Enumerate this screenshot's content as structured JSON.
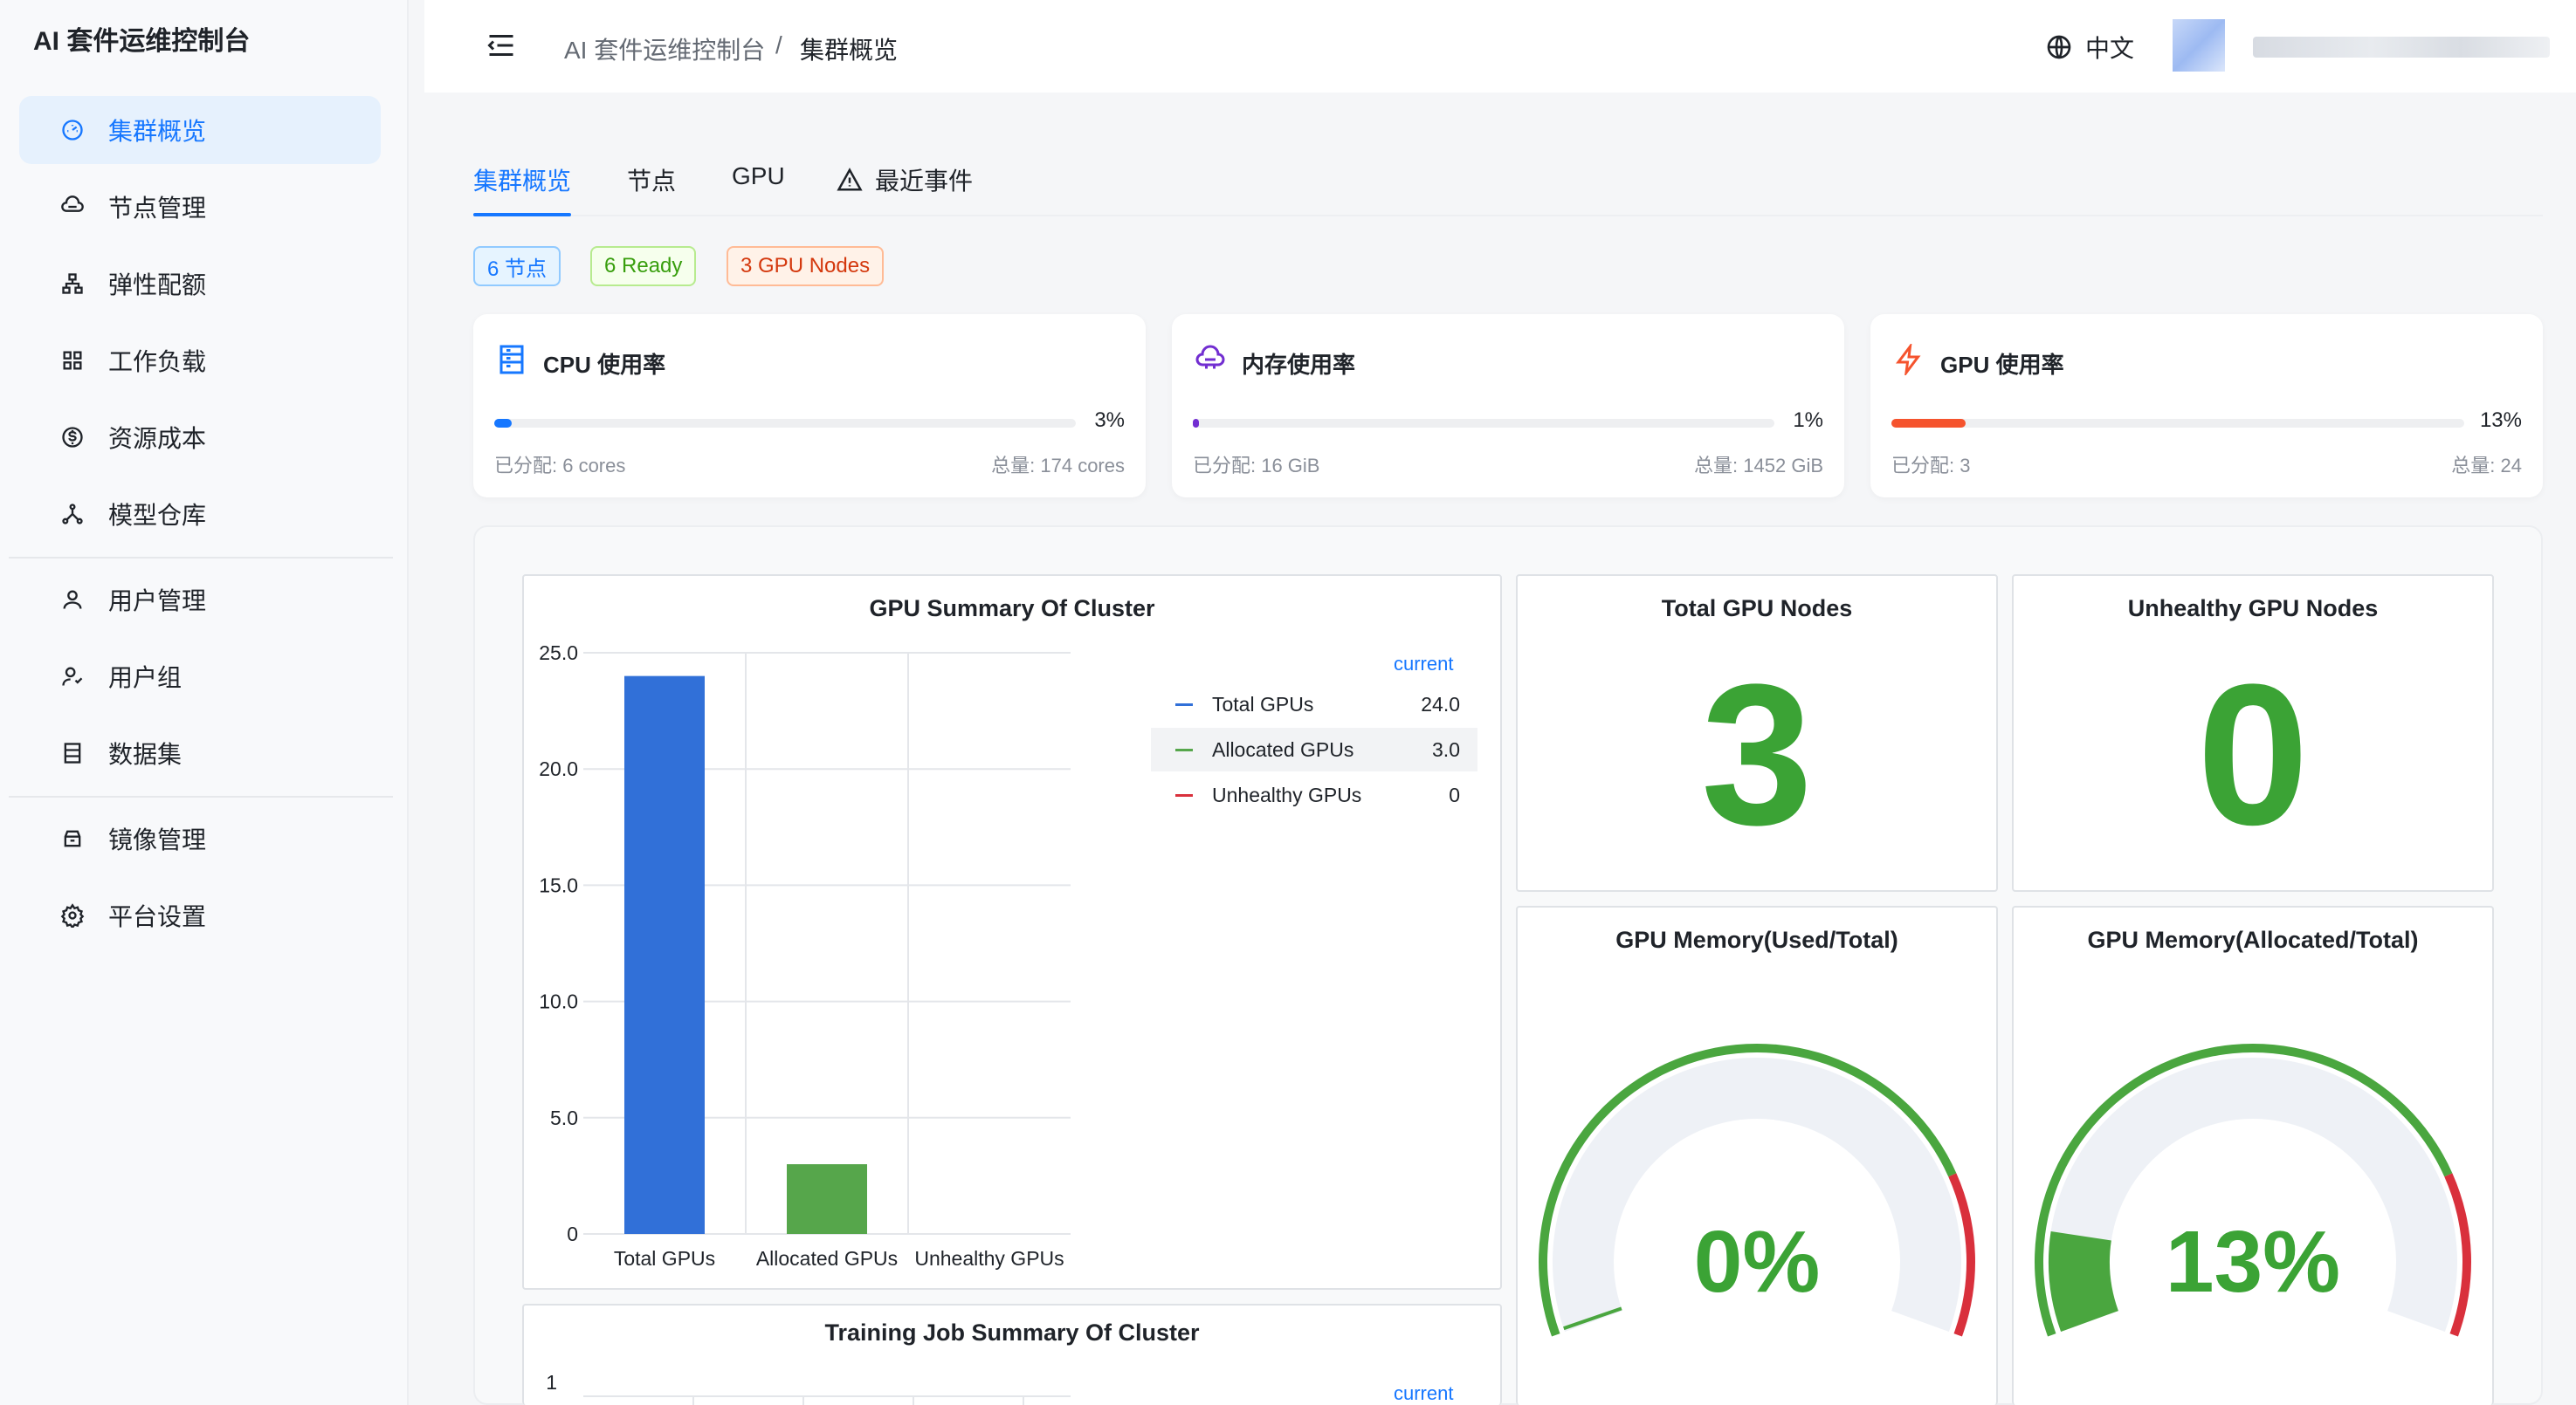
{
  "app": {
    "title": "AI 套件运维控制台"
  },
  "sidebar": {
    "items": [
      {
        "label": "集群概览",
        "icon": "dashboard-icon",
        "active": true
      },
      {
        "label": "节点管理",
        "icon": "cloud-node-icon"
      },
      {
        "label": "弹性配额",
        "icon": "cluster-icon"
      },
      {
        "label": "工作负载",
        "icon": "grid-icon"
      },
      {
        "label": "资源成本",
        "icon": "dollar-icon"
      },
      {
        "label": "模型仓库",
        "icon": "nodes-icon"
      },
      {
        "label": "用户管理",
        "icon": "user-icon"
      },
      {
        "label": "用户组",
        "icon": "user-group-icon"
      },
      {
        "label": "数据集",
        "icon": "dataset-icon"
      },
      {
        "label": "镜像管理",
        "icon": "image-box-icon"
      },
      {
        "label": "平台设置",
        "icon": "gear-icon"
      }
    ]
  },
  "header": {
    "breadcrumb": [
      "AI 套件运维控制台",
      "集群概览"
    ],
    "breadcrumb_sep": "/",
    "language": "中文"
  },
  "tabs": [
    {
      "label": "集群概览",
      "active": true
    },
    {
      "label": "节点"
    },
    {
      "label": "GPU"
    },
    {
      "label": "最近事件",
      "icon": "warning-icon"
    }
  ],
  "tags": [
    "6 节点",
    "6 Ready",
    "3 GPU Nodes"
  ],
  "stats": [
    {
      "title": "CPU 使用率",
      "percent_label": "3%",
      "percent": 3,
      "allocated": "已分配: 6 cores",
      "total": "总量: 174 cores",
      "color": "#1677ff",
      "icon": "server-icon"
    },
    {
      "title": "内存使用率",
      "percent_label": "1%",
      "percent": 1,
      "allocated": "已分配: 16 GiB",
      "total": "总量: 1452 GiB",
      "color": "#722ed1",
      "icon": "memory-icon"
    },
    {
      "title": "GPU 使用率",
      "percent_label": "13%",
      "percent": 13,
      "allocated": "已分配: 3",
      "total": "总量: 24",
      "color": "#f5532d",
      "icon": "lightning-icon"
    }
  ],
  "panels": {
    "gpu_summary_title": "GPU Summary Of Cluster",
    "total_gpu_nodes_title": "Total GPU Nodes",
    "total_gpu_nodes_value": "3",
    "unhealthy_gpu_nodes_title": "Unhealthy GPU Nodes",
    "unhealthy_gpu_nodes_value": "0",
    "mem_used_title": "GPU Memory(Used/Total)",
    "mem_used_value": "0%",
    "mem_alloc_title": "GPU Memory(Allocated/Total)",
    "mem_alloc_value": "13%",
    "training_title": "Training Job Summary Of Cluster",
    "legend_header": "current",
    "training_legend_header": "current"
  },
  "colors": {
    "green": "#3ba335",
    "red": "#d9303c",
    "blue": "#3170d8"
  },
  "chart_data": [
    {
      "type": "bar",
      "title": "GPU Summary Of Cluster",
      "categories": [
        "Total GPUs",
        "Allocated GPUs",
        "Unhealthy GPUs"
      ],
      "values": [
        24,
        3,
        0
      ],
      "colors": [
        "#3170d8",
        "#56a64b",
        "#d9303c"
      ],
      "ylim": [
        0,
        25
      ],
      "yticks": [
        "0",
        "5.0",
        "10.0",
        "15.0",
        "20.0",
        "25.0"
      ],
      "legend": [
        {
          "name": "Total GPUs",
          "value": "24.0",
          "color": "#3170d8"
        },
        {
          "name": "Allocated GPUs",
          "value": "3.0",
          "color": "#56a64b"
        },
        {
          "name": "Unhealthy GPUs",
          "value": "0",
          "color": "#d9303c"
        }
      ],
      "legend_placement": "right",
      "grid": true
    },
    {
      "type": "gauge",
      "title": "GPU Memory(Used/Total)",
      "value": 0,
      "value_label": "0%"
    },
    {
      "type": "gauge",
      "title": "GPU Memory(Allocated/Total)",
      "value": 13,
      "value_label": "13%"
    },
    {
      "type": "bar",
      "title": "Training Job Summary Of Cluster",
      "yticks": [
        "1"
      ],
      "legend_header": "current"
    }
  ]
}
